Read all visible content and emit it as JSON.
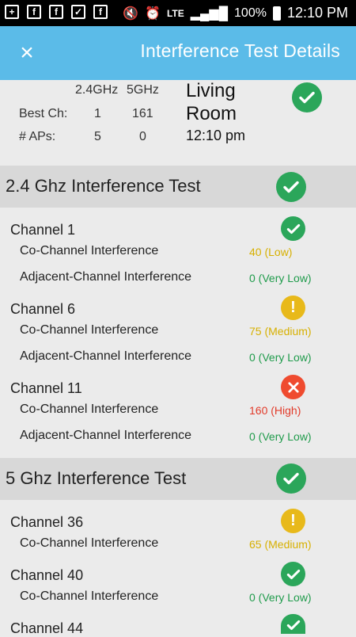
{
  "status_bar": {
    "time": "12:10 PM",
    "battery": "100%",
    "network": "LTE"
  },
  "app_bar": {
    "title": "Interference Test Details",
    "close_label": "×"
  },
  "summary": {
    "band_labels": [
      "2.4GHz",
      "5GHz"
    ],
    "best_ch_label": "Best Ch:",
    "best_ch_values": [
      "1",
      "161"
    ],
    "aps_label": "# APs:",
    "aps_values": [
      "5",
      "0"
    ],
    "location": "Living Room",
    "time": "12:10 pm"
  },
  "sections": [
    {
      "title": "2.4 Ghz Interference Test",
      "status": "ok",
      "channels": [
        {
          "name": "Channel 1",
          "status": "ok",
          "metrics": [
            {
              "label": "Co-Channel Interference",
              "value": "40 (Low)",
              "level": "low"
            },
            {
              "label": "Adjacent-Channel Interference",
              "value": "0 (Very Low)",
              "level": "very-low"
            }
          ]
        },
        {
          "name": "Channel 6",
          "status": "warn",
          "metrics": [
            {
              "label": "Co-Channel Interference",
              "value": "75 (Medium)",
              "level": "medium"
            },
            {
              "label": "Adjacent-Channel Interference",
              "value": "0 (Very Low)",
              "level": "very-low"
            }
          ]
        },
        {
          "name": "Channel 11",
          "status": "bad",
          "metrics": [
            {
              "label": "Co-Channel Interference",
              "value": "160 (High)",
              "level": "high"
            },
            {
              "label": "Adjacent-Channel Interference",
              "value": "0 (Very Low)",
              "level": "very-low"
            }
          ]
        }
      ]
    },
    {
      "title": "5 Ghz Interference Test",
      "status": "ok",
      "channels": [
        {
          "name": "Channel 36",
          "status": "warn",
          "metrics": [
            {
              "label": "Co-Channel Interference",
              "value": "65 (Medium)",
              "level": "medium"
            }
          ]
        },
        {
          "name": "Channel 40",
          "status": "ok",
          "metrics": [
            {
              "label": "Co-Channel Interference",
              "value": "0 (Very Low)",
              "level": "very-low"
            }
          ]
        },
        {
          "name": "Channel 44",
          "status": "ok",
          "metrics": []
        }
      ]
    }
  ],
  "colors": {
    "accent": "#5bbbe8",
    "ok": "#2ba65a",
    "warn": "#e8b91a",
    "bad": "#ef4b2f"
  }
}
